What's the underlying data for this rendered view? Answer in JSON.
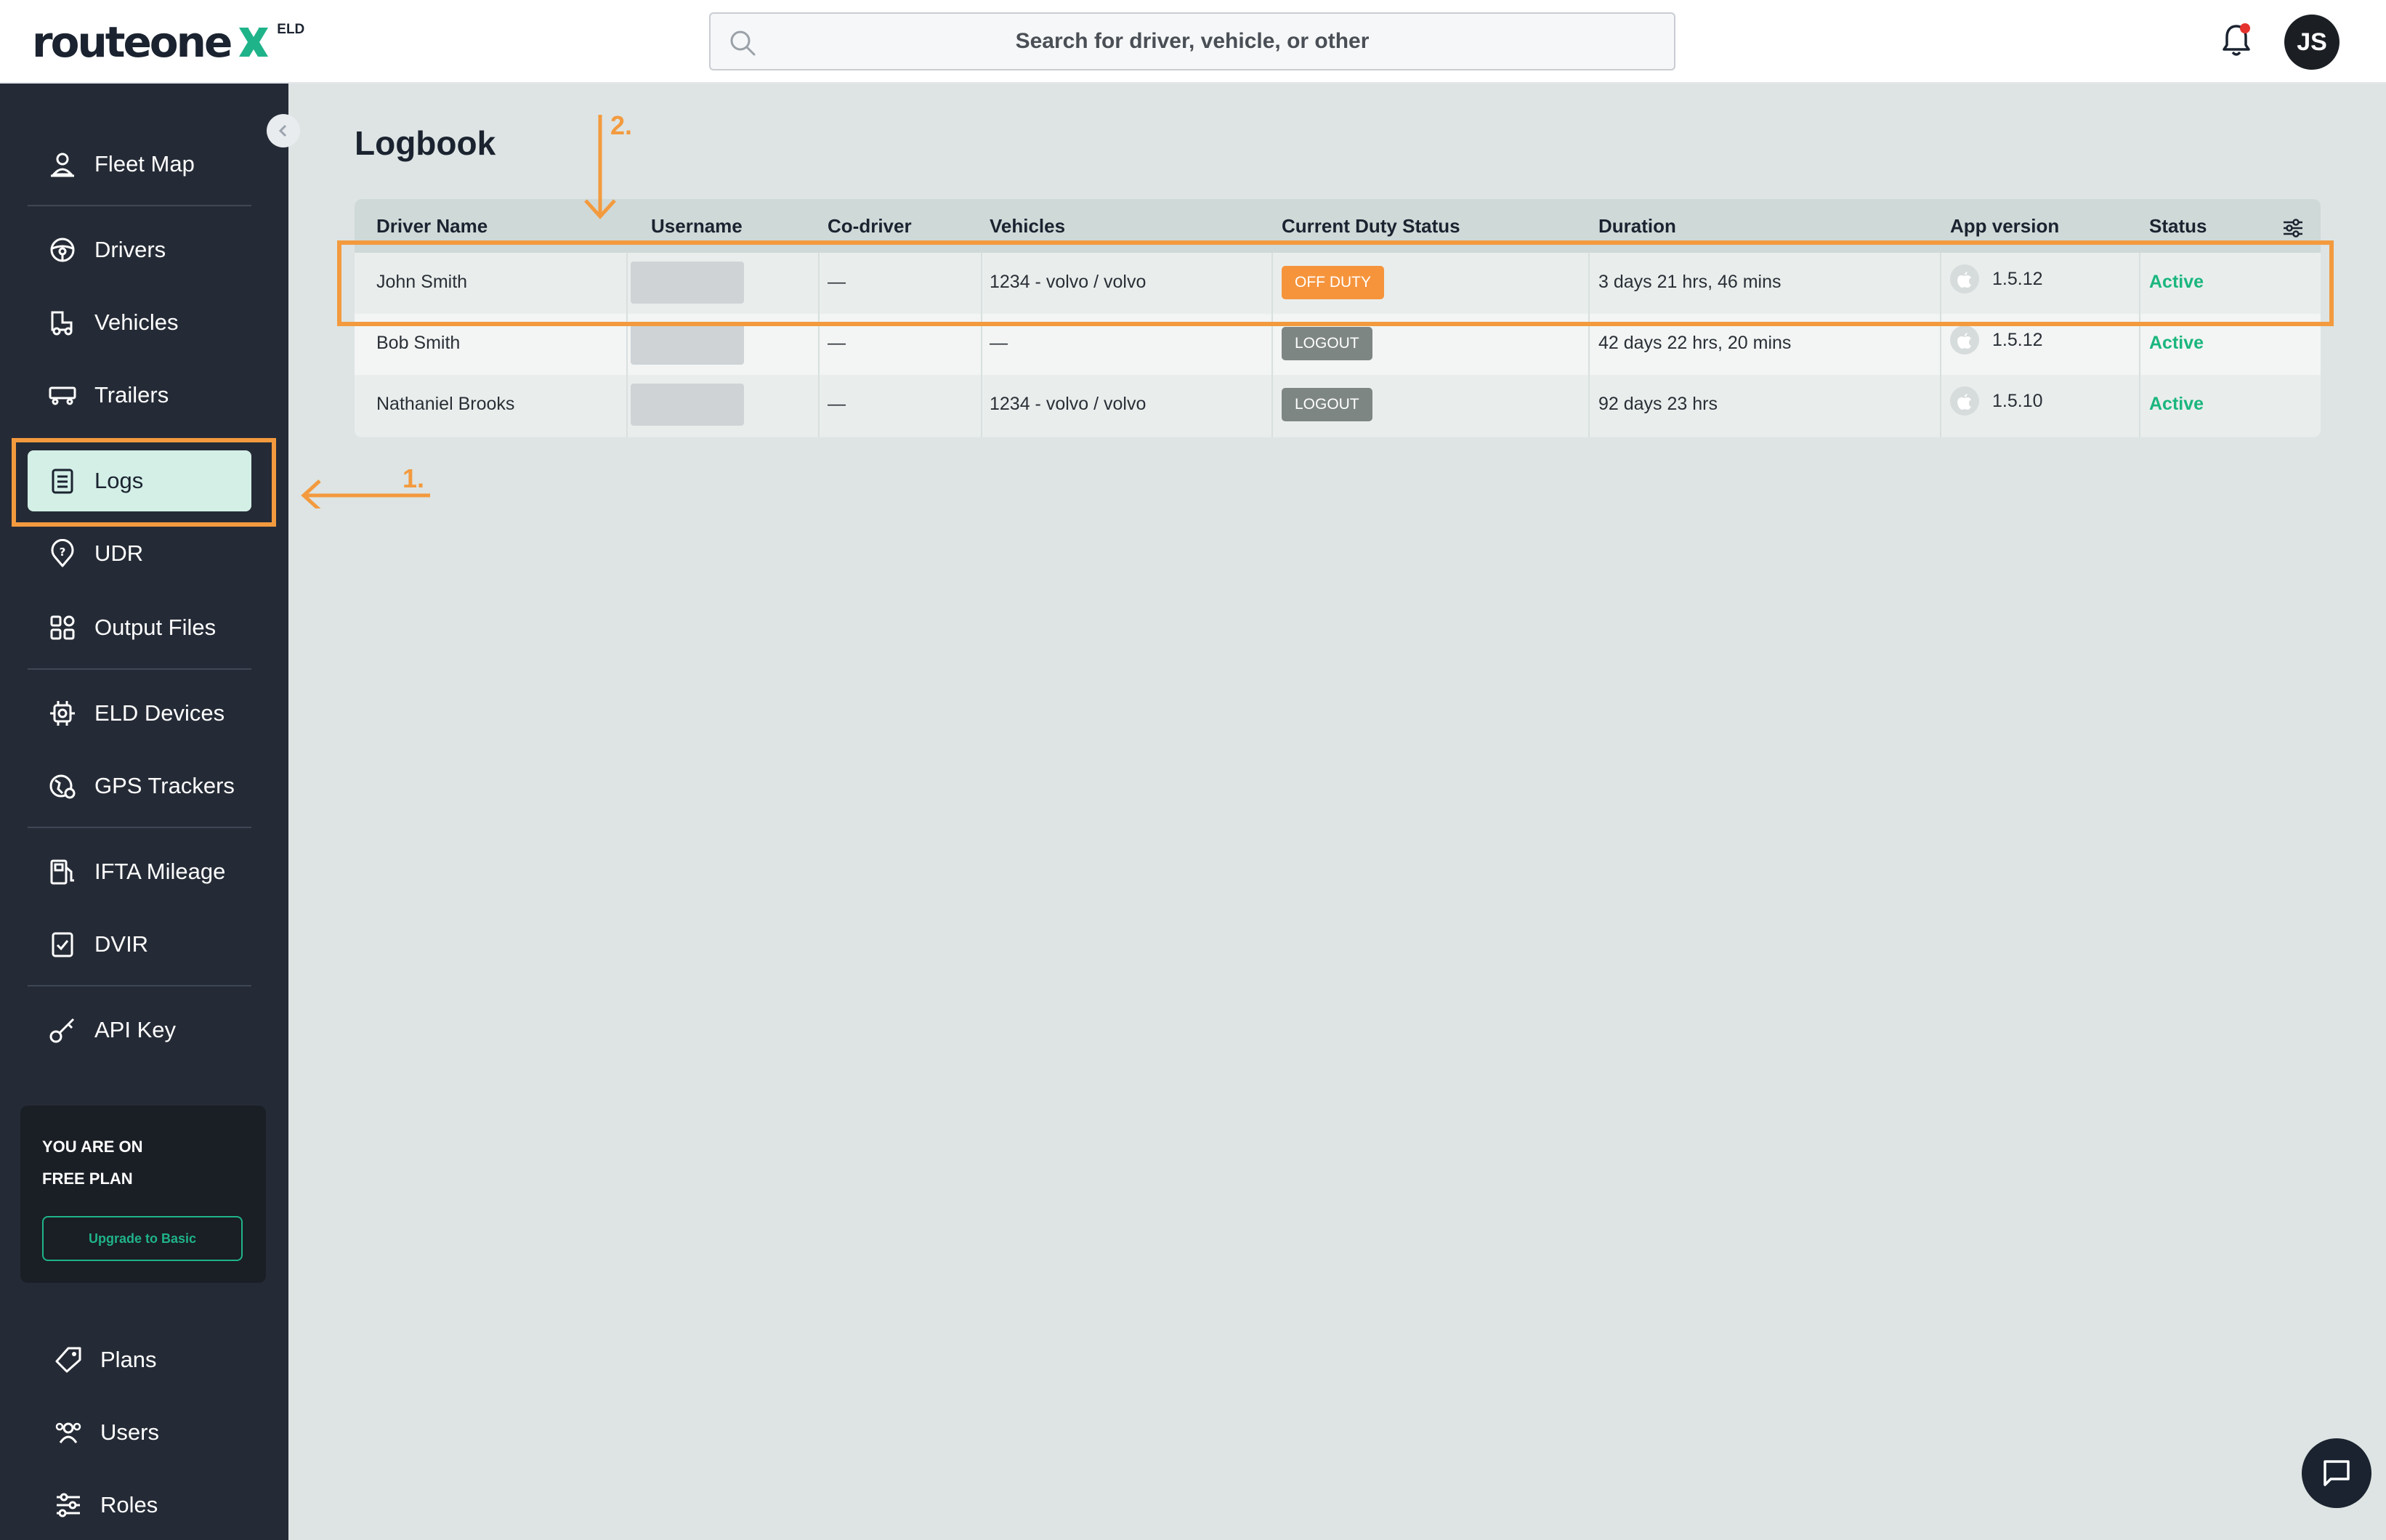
{
  "brand": {
    "logo_text": "routeone",
    "logo_suffix": "ELD",
    "accent_color": "#1fb38a",
    "annotation_color": "#f39a3e"
  },
  "header": {
    "search_placeholder": "Search for driver, vehicle, or other",
    "avatar_initials": "JS",
    "bell_icon": "bell-icon",
    "has_notification": true
  },
  "sidebar": {
    "items": [
      {
        "label": "Fleet Map",
        "icon": "map-pin-person-icon"
      },
      {
        "label": "Drivers",
        "icon": "steering-wheel-icon"
      },
      {
        "label": "Vehicles",
        "icon": "truck-icon"
      },
      {
        "label": "Trailers",
        "icon": "trailer-icon"
      },
      {
        "label": "Logs",
        "icon": "clipboard-list-icon",
        "active": true
      },
      {
        "label": "UDR",
        "icon": "question-pin-icon"
      },
      {
        "label": "Output Files",
        "icon": "grid-icon"
      },
      {
        "label": "ELD Devices",
        "icon": "chip-icon"
      },
      {
        "label": "GPS Trackers",
        "icon": "gps-icon"
      },
      {
        "label": "IFTA Mileage",
        "icon": "fuel-icon"
      },
      {
        "label": "DVIR",
        "icon": "clipboard-check-icon"
      },
      {
        "label": "API Key",
        "icon": "key-icon"
      }
    ],
    "plan": {
      "line1": "YOU ARE ON",
      "line2": "FREE PLAN",
      "upgrade_label": "Upgrade to Basic"
    },
    "bottom_items": [
      {
        "label": "Plans",
        "icon": "tag-icon"
      },
      {
        "label": "Users",
        "icon": "users-icon"
      },
      {
        "label": "Roles",
        "icon": "sliders-icon"
      }
    ]
  },
  "main": {
    "title": "Logbook",
    "table": {
      "columns": [
        "Driver Name",
        "Username",
        "Co-driver",
        "Vehicles",
        "Current Duty Status",
        "Duration",
        "App version",
        "Status"
      ],
      "rows": [
        {
          "driver": "John Smith",
          "username": "",
          "co_driver": "—",
          "vehicles": "1234 - volvo / volvo",
          "duty_status": "OFF DUTY",
          "duty_color": "#f6943c",
          "duration": "3 days 21 hrs, 46 mins",
          "app_version": "1.5.12",
          "status": "Active"
        },
        {
          "driver": "Bob Smith",
          "username": "",
          "co_driver": "—",
          "vehicles": "—",
          "duty_status": "LOGOUT",
          "duty_color": "#7e8684",
          "duration": "42 days 22 hrs, 20 mins",
          "app_version": "1.5.12",
          "status": "Active"
        },
        {
          "driver": "Nathaniel Brooks",
          "username": "",
          "co_driver": "—",
          "vehicles": "1234 - volvo / volvo",
          "duty_status": "LOGOUT",
          "duty_color": "#7e8684",
          "duration": "92 days 23 hrs",
          "app_version": "1.5.10",
          "status": "Active"
        }
      ]
    }
  },
  "annotations": {
    "step1": "1.",
    "step2": "2."
  }
}
